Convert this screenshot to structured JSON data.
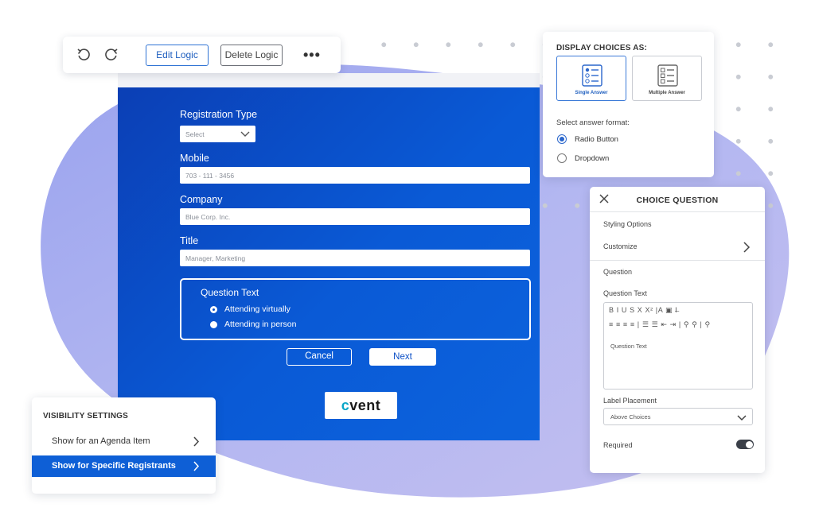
{
  "toolbar": {
    "undo_icon": "undo-icon",
    "redo_icon": "redo-icon",
    "edit_logic_label": "Edit Logic",
    "delete_logic_label": "Delete Logic",
    "more_label": "•••"
  },
  "form": {
    "registration_type_label": "Registration Type",
    "registration_type_value": "Select",
    "mobile_label": "Mobile",
    "mobile_placeholder": "703 - 111 - 3456",
    "company_label": "Company",
    "company_placeholder": "Blue Corp. Inc.",
    "title_label": "Title",
    "title_placeholder": "Manager, Marketing",
    "question": {
      "title": "Question Text",
      "options": [
        {
          "label": "Attending virtually",
          "selected": true
        },
        {
          "label": "Attending in person",
          "selected": false
        }
      ]
    },
    "cancel_label": "Cancel",
    "next_label": "Next",
    "logo_prefix": "c",
    "logo_rest": "vent"
  },
  "display_choices": {
    "title": "DISPLAY CHOICES AS:",
    "single_label": "Single Answer",
    "multiple_label": "Multiple Answer",
    "format_label": "Select answer format:",
    "radio_button_label": "Radio Button",
    "dropdown_label": "Dropdown",
    "selected_format": "Radio Button"
  },
  "choice_question": {
    "title": "CHOICE QUESTION",
    "styling_options_label": "Styling Options",
    "customize_label": "Customize",
    "question_label": "Question",
    "question_text_label": "Question Text",
    "toolbar_row1": "B I U S X X² |A ▣ I̶ ",
    "toolbar_row2": "≡ ≡ ≡ ≡ | ☰ ☰ ⇤ ⇥ | ⚲ ⚲ | ⚲",
    "editor_placeholder": "Question Text",
    "label_placement_label": "Label Placement",
    "label_placement_value": "Above Choices",
    "required_label": "Required",
    "required_on": true
  },
  "visibility": {
    "title": "VISIBILITY SETTINGS",
    "items": [
      {
        "label": "Show for an Agenda Item",
        "active": false
      },
      {
        "label": "Show for Specific Registrants",
        "active": true
      }
    ]
  },
  "colors": {
    "brand_blue": "#0b4fc6",
    "active_blue": "#0e5fd6",
    "logo_teal": "#0aa6c8"
  }
}
